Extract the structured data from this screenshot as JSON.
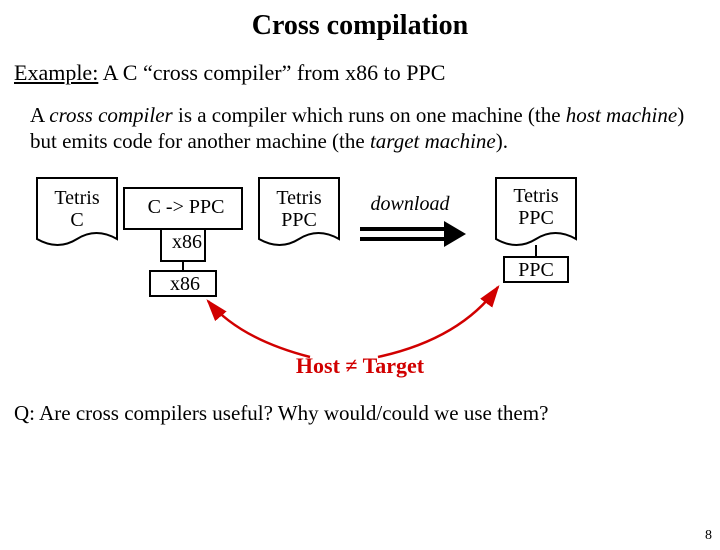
{
  "title": "Cross compilation",
  "example_prefix": "Example:",
  "example_rest": " A C “cross compiler” from x86 to PPC",
  "definition_html_parts": {
    "lead": "A ",
    "ital1": "cross compiler",
    "mid": " is a compiler which runs on one machine (the ",
    "ital2": "host machine",
    "mid2": ") but emits code for another machine (the ",
    "ital3": "target machine",
    "tail": ")."
  },
  "labels": {
    "tetris_c_l1": "Tetris",
    "tetris_c_l2": "C",
    "compiler_top": "C -> PPC",
    "compiler_mid": "x86",
    "compiler_run": "x86",
    "tetris_ppc_l1": "Tetris",
    "tetris_ppc_l2": "PPC",
    "download": "download",
    "target_l1": "Tetris",
    "target_l2": "PPC",
    "target_l3": "PPC"
  },
  "host_ne_target": "Host ≠ Target",
  "question": "Q: Are cross compilers useful? Why would/could we use them?",
  "page": "8"
}
